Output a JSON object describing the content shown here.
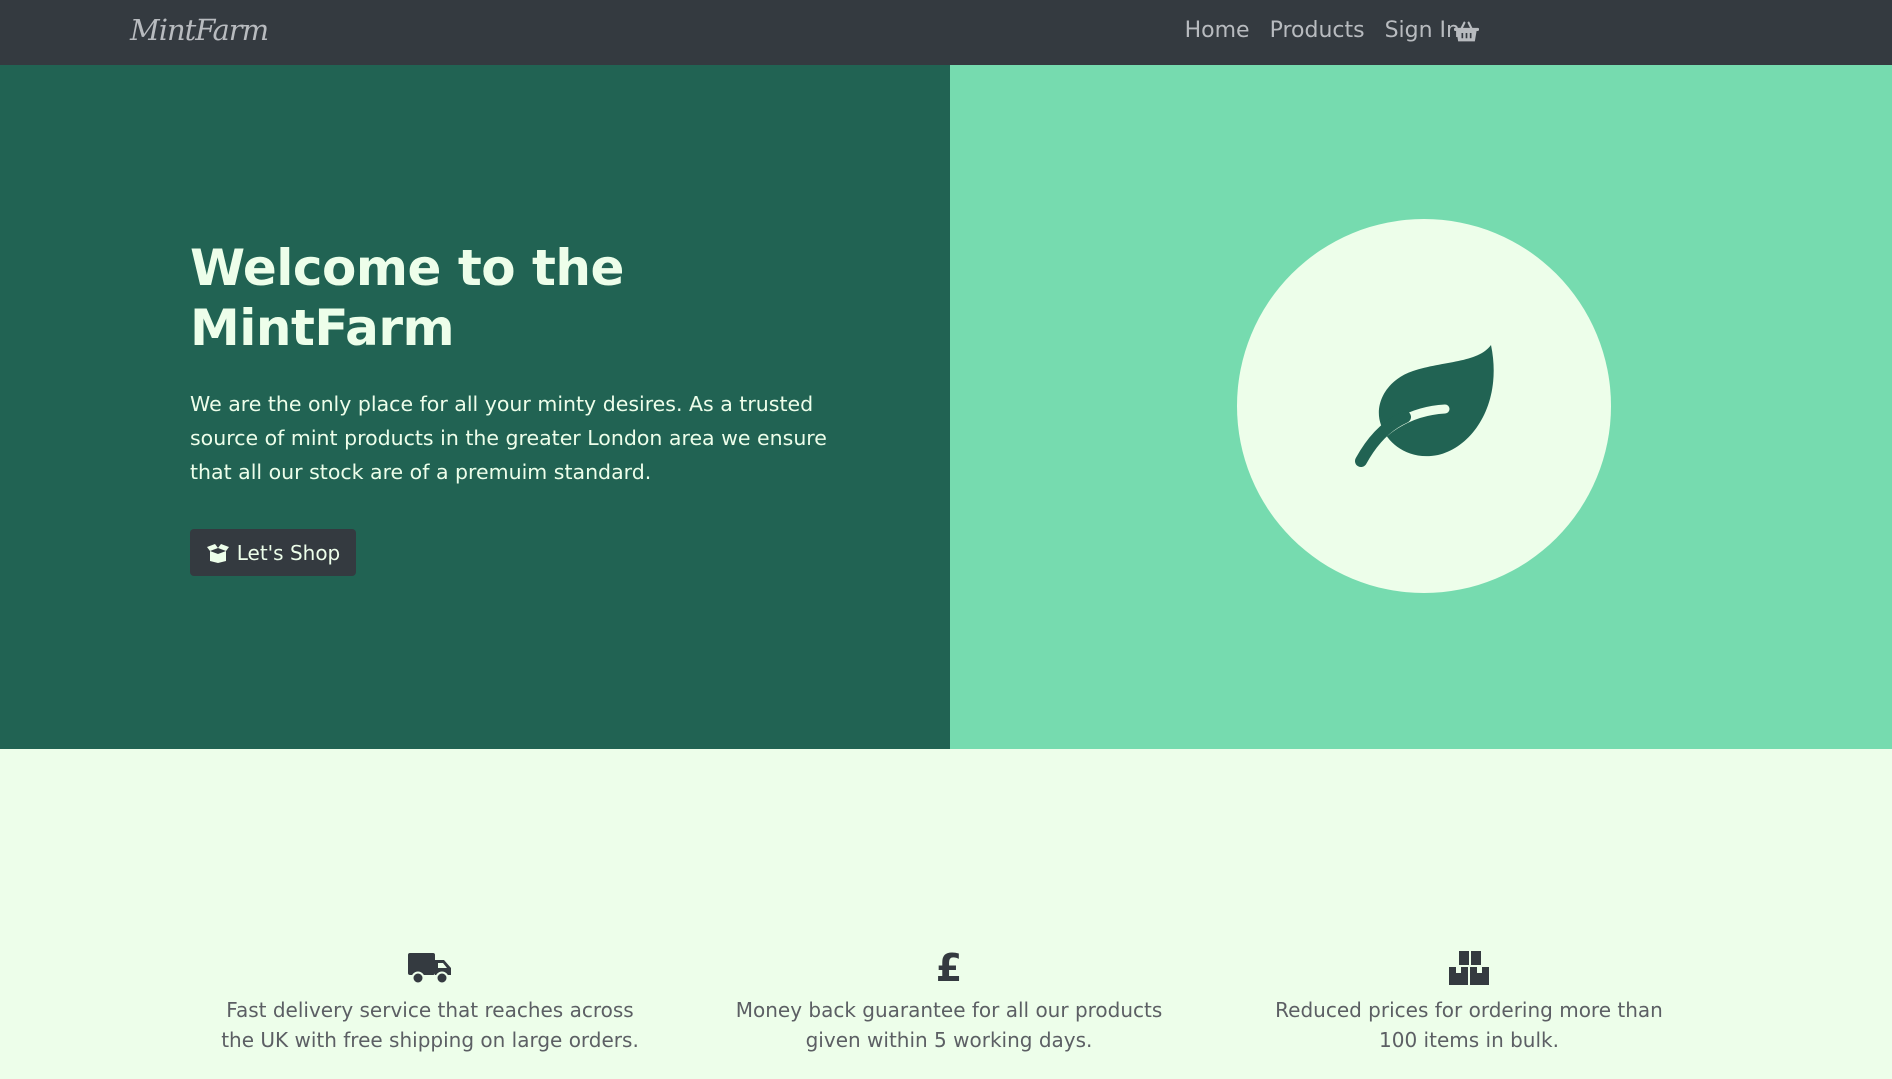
{
  "nav": {
    "brand": "MintFarm",
    "links": [
      "Home",
      "Products",
      "Sign In"
    ],
    "cart_icon": "shopping-basket-icon"
  },
  "hero": {
    "title": "Welcome to the MintFarm",
    "description": "We are the only place for all your minty desires. As a trusted source of mint products in the greater London area we ensure that all our stock are of a premuim standard.",
    "button_label": "Let's Shop",
    "button_icon": "open-box-icon",
    "illustration_icon": "leaf-icon"
  },
  "features": [
    {
      "icon": "truck-icon",
      "text": "Fast delivery service that reaches across the UK with free shipping on large orders."
    },
    {
      "icon": "pound-sign-icon",
      "symbol": "£",
      "text": "Money back guarantee for all our products given within 5 working days."
    },
    {
      "icon": "boxes-icon",
      "text": "Reduced prices for ordering more than 100 items in bulk."
    }
  ],
  "colors": {
    "navbar": "#343a40",
    "hero_left": "#216353",
    "hero_right": "#76dbaf",
    "page_bg": "#edfeea",
    "text_light": "#edfeea",
    "nav_text": "#b8bbbf"
  }
}
